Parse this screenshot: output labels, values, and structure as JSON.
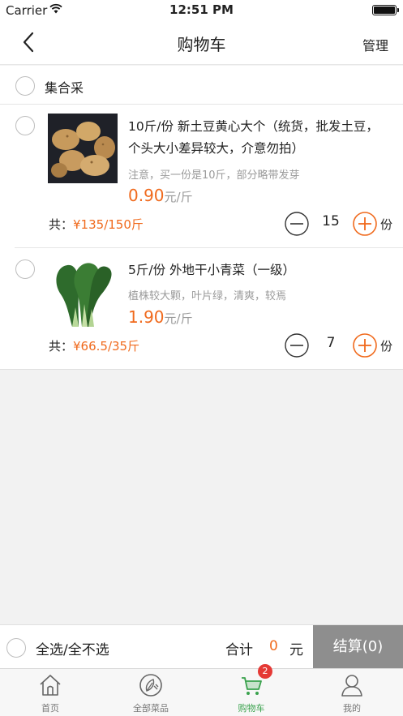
{
  "status_bar": {
    "carrier": "Carrier",
    "time": "12:51 PM"
  },
  "nav": {
    "title": "购物车",
    "manage_label": "管理"
  },
  "group": {
    "label": "集合采"
  },
  "cart_items": [
    {
      "name": "10斤/份 新土豆黄心大个（统货，批发土豆，个头大小差异较大，介意勿拍）",
      "note": "注意，买一份是10斤，部分略带发芽",
      "price": "0.90",
      "price_unit": "元/斤",
      "total_label": "共：",
      "total_value": "¥135/150斤",
      "quantity": "15",
      "quantity_unit": "份"
    },
    {
      "name": "5斤/份 外地干小青菜（一级）",
      "note": "植株较大颗，叶片绿，清爽，较焉",
      "price": "1.90",
      "price_unit": "元/斤",
      "total_label": "共：",
      "total_value": "¥66.5/35斤",
      "quantity": "7",
      "quantity_unit": "份"
    }
  ],
  "checkout": {
    "select_all_label": "全选/全不选",
    "sum_label": "合计",
    "sum_value": "0",
    "sum_unit": "元",
    "settle_label": "结算(0)"
  },
  "tabbar": {
    "tabs": [
      {
        "label": "首页",
        "icon": "home-icon"
      },
      {
        "label": "全部菜品",
        "icon": "vegetables-icon"
      },
      {
        "label": "购物车",
        "icon": "cart-icon"
      },
      {
        "label": "我的",
        "icon": "user-icon"
      }
    ],
    "cart_badge": "2"
  },
  "colors": {
    "accent": "#f06a1d",
    "active_tab": "#3aa24d",
    "settle_bg": "#8e8e8e",
    "badge": "#e53935"
  }
}
